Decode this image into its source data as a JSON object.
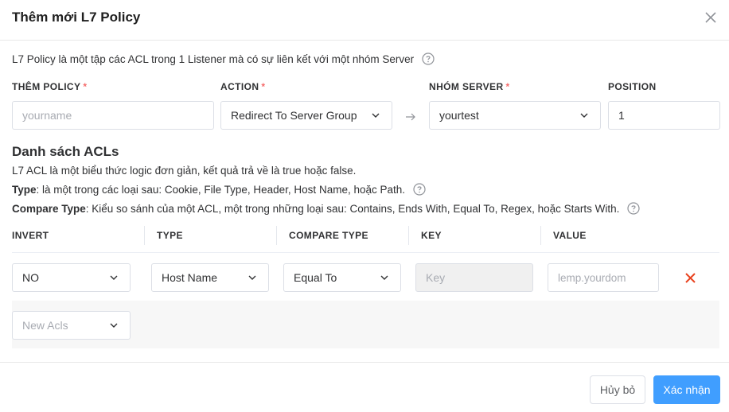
{
  "dialog": {
    "title": "Thêm mới L7 Policy"
  },
  "intro": {
    "text": "L7 Policy là một tập các ACL trong 1 Listener mà có sự liên kết với một nhóm Server"
  },
  "form": {
    "policy_label": "THÊM POLICY",
    "policy_placeholder": "yourname",
    "action_label": "ACTION",
    "action_value": "Redirect To Server Group",
    "server_group_label": "NHÓM SERVER",
    "server_group_value": "yourtest",
    "position_label": "POSITION",
    "position_value": "1",
    "required_mark": "*"
  },
  "acls": {
    "title": "Danh sách ACLs",
    "desc": "L7 ACL là một biểu thức logic đơn giản, kết quả trả về là true hoặc false.",
    "type_term": "Type",
    "type_desc": ": là một trong các loại sau: Cookie, File Type, Header, Host Name, hoặc Path.",
    "compare_term": "Compare Type",
    "compare_desc": ": Kiểu so sánh của một ACL, một trong những loại sau: Contains, Ends With, Equal To, Regex, hoặc Starts With.",
    "columns": [
      "INVERT",
      "TYPE",
      "COMPARE TYPE",
      "KEY",
      "VALUE"
    ],
    "rows": [
      {
        "invert": "NO",
        "type": "Host Name",
        "compare_type": "Equal To",
        "key_placeholder": "Key",
        "value_placeholder": "lemp.yourdom"
      }
    ],
    "new_acls_placeholder": "New Acls"
  },
  "footer": {
    "cancel_label": "Hủy bỏ",
    "confirm_label": "Xác nhận"
  },
  "colors": {
    "primary": "#409eff",
    "danger": "#f56c6c",
    "delete_icon": "#e8431f"
  },
  "icons": [
    "close-icon",
    "help-icon",
    "chevron-down-icon",
    "arrow-right-icon",
    "delete-icon"
  ]
}
